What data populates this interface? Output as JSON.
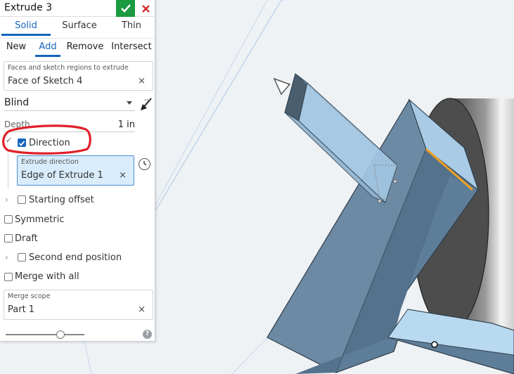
{
  "dialog": {
    "title": "Extrude 3",
    "tabs": [
      "Solid",
      "Surface",
      "Thin"
    ],
    "operations": [
      "New",
      "Add",
      "Remove",
      "Intersect"
    ],
    "faces_field": {
      "label": "Faces and sketch regions to extrude",
      "value": "Face of Sketch 4"
    },
    "end_type": "Blind",
    "depth": {
      "label": "Depth",
      "value": "1 in"
    },
    "direction": {
      "label": "Direction",
      "checked": true
    },
    "extrude_direction": {
      "label": "Extrude direction",
      "value": "Edge of Extrude 1"
    },
    "starting_offset": "Starting offset",
    "symmetric": "Symmetric",
    "draft": "Draft",
    "second_end": "Second end position",
    "merge_with_all": "Merge with all",
    "merge_scope": {
      "label": "Merge scope",
      "value": "Part 1"
    },
    "clear_symbol": "×",
    "help_symbol": "?"
  },
  "colors": {
    "accent": "#1565c0",
    "ok": "#1b9a3f",
    "cancel": "#d32f2f",
    "annotation": "#e0202a",
    "highlight_edge": "#f2a024"
  }
}
